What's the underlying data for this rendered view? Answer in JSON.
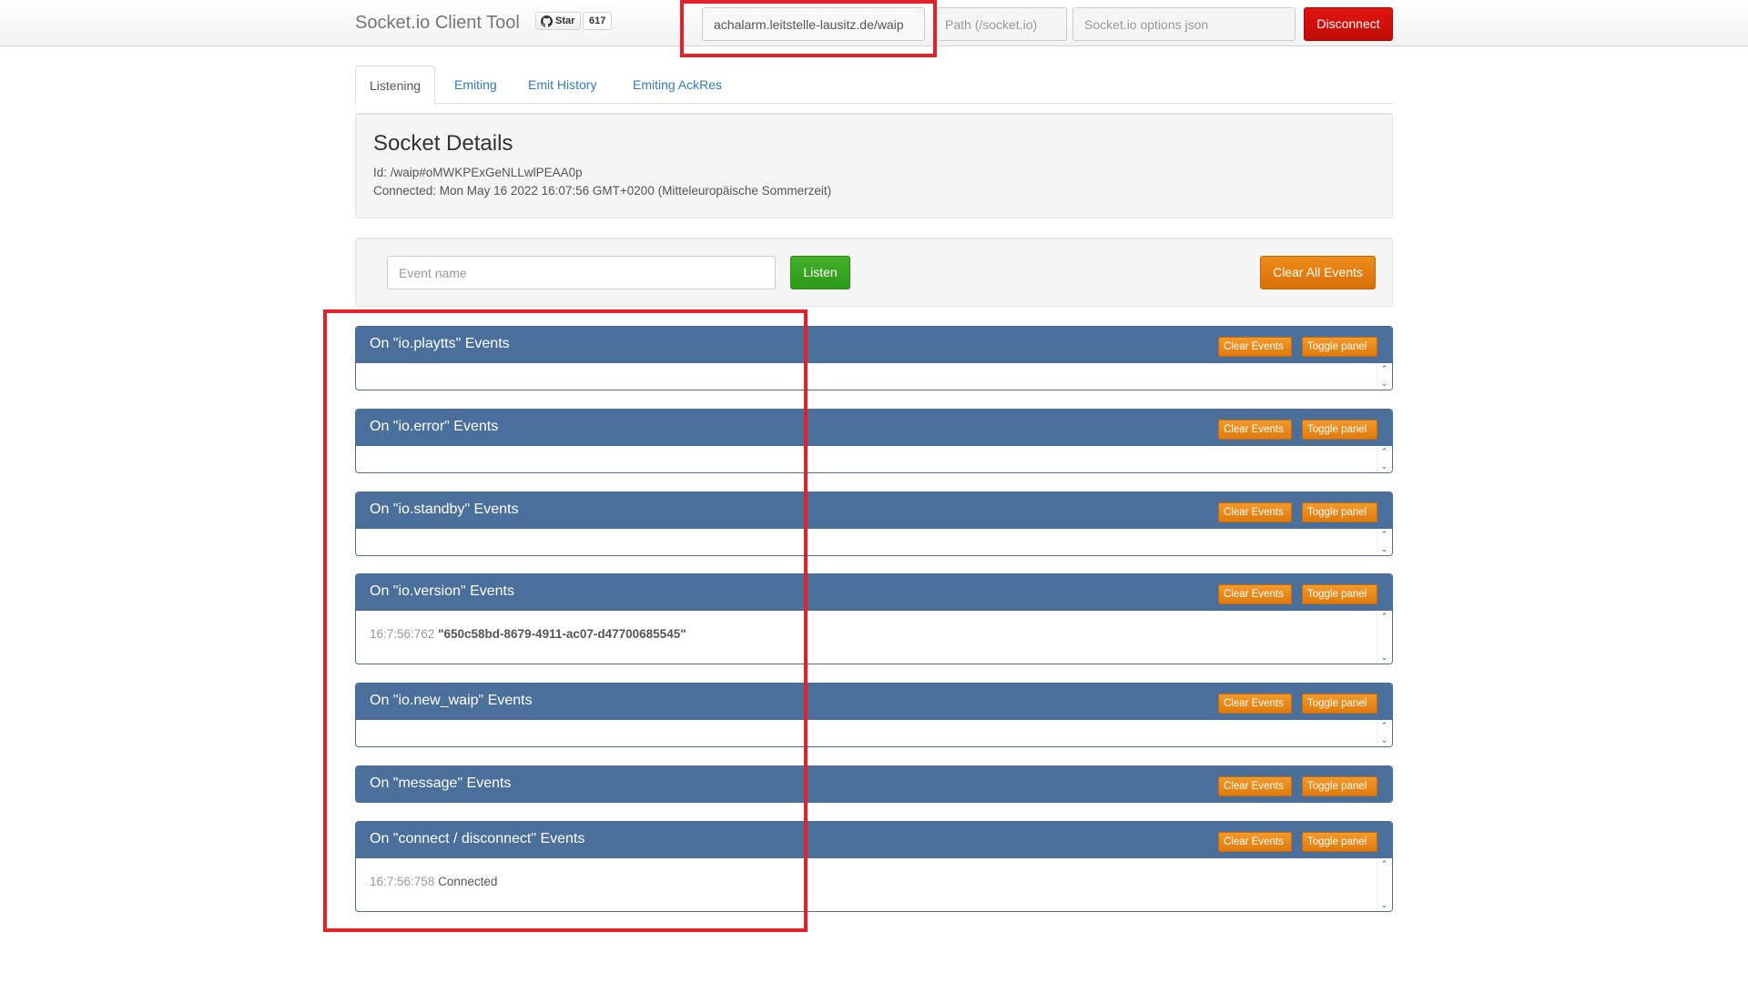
{
  "navbar": {
    "brand": "Socket.io Client Tool",
    "github_star_label": "Star",
    "github_star_count": "617",
    "url_value": "achalarm.leitstelle-lausitz.de/waip",
    "path_placeholder": "Path (/socket.io)",
    "options_placeholder": "Socket.io options json",
    "disconnect_label": "Disconnect"
  },
  "tabs": [
    {
      "label": "Listening",
      "active": true
    },
    {
      "label": "Emiting",
      "active": false
    },
    {
      "label": "Emit History",
      "active": false
    },
    {
      "label": "Emiting AckRes",
      "active": false
    }
  ],
  "socket_details": {
    "title": "Socket Details",
    "id_line": "Id: /waip#oMWKPExGeNLLwlPEAA0p",
    "connected_line": "Connected: Mon May 16 2022 16:07:56 GMT+0200 (Mitteleuropäische Sommerzeit)"
  },
  "listen": {
    "event_placeholder": "Event name",
    "listen_label": "Listen",
    "clear_all_label": "Clear All Events"
  },
  "panel_buttons": {
    "clear_label": "Clear Events",
    "toggle_label": "Toggle panel"
  },
  "panels": [
    {
      "title": "On \"io.playtts\" Events",
      "events": []
    },
    {
      "title": "On \"io.error\" Events",
      "events": []
    },
    {
      "title": "On \"io.standby\" Events",
      "events": []
    },
    {
      "title": "On \"io.version\" Events",
      "events": [
        {
          "time": "16:7:56:762",
          "value": "\"650c58bd-8679-4911-ac07-d47700685545\""
        }
      ]
    },
    {
      "title": "On \"io.new_waip\" Events",
      "events": []
    },
    {
      "title": "On \"message\" Events",
      "events": []
    },
    {
      "title": "On \"connect / disconnect\" Events",
      "events": [
        {
          "time": "16:7:56:758",
          "value": "Connected"
        }
      ]
    }
  ],
  "colors": {
    "panel_heading": "#4b6f9b",
    "disconnect": "#d0100c",
    "listen": "#3aa622",
    "clear_orange": "#e5800f",
    "highlight_red": "#e5202a"
  }
}
